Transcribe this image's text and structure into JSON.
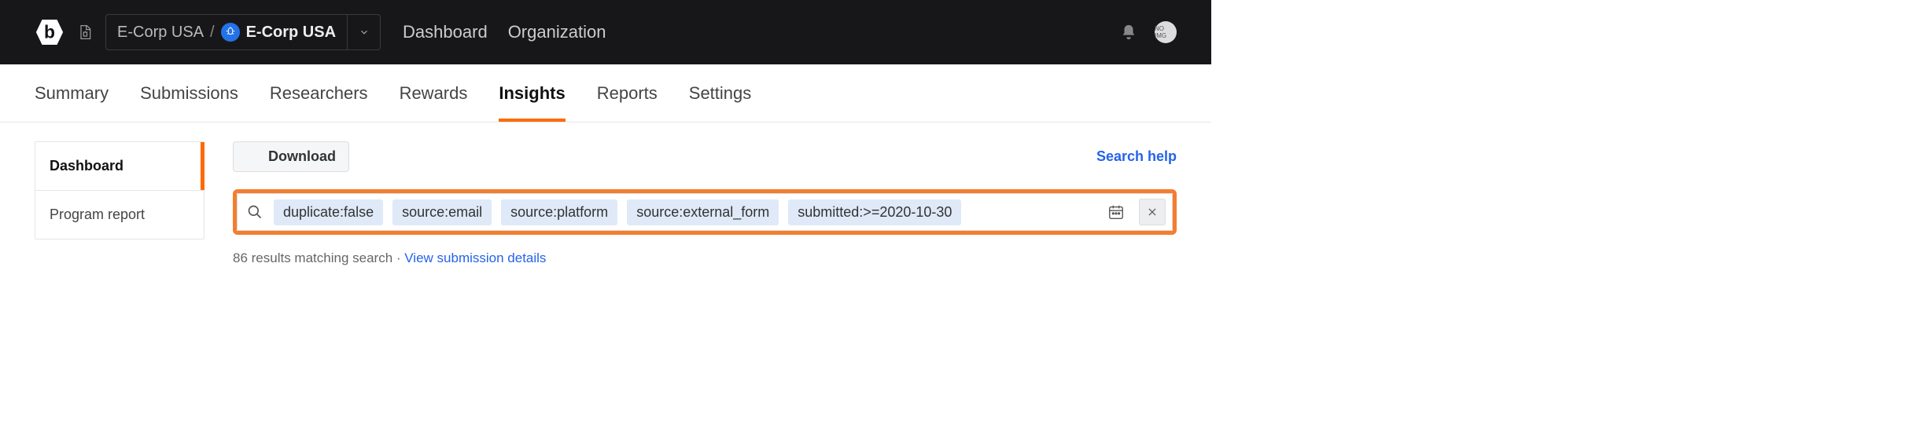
{
  "header": {
    "breadcrumb": {
      "parent": "E-Corp USA",
      "current": "E-Corp USA"
    },
    "nav": [
      "Dashboard",
      "Organization"
    ]
  },
  "subnav": {
    "items": [
      {
        "label": "Summary",
        "active": false
      },
      {
        "label": "Submissions",
        "active": false
      },
      {
        "label": "Researchers",
        "active": false
      },
      {
        "label": "Rewards",
        "active": false
      },
      {
        "label": "Insights",
        "active": true
      },
      {
        "label": "Reports",
        "active": false
      },
      {
        "label": "Settings",
        "active": false
      }
    ]
  },
  "sidebar": {
    "items": [
      {
        "label": "Dashboard",
        "active": true
      },
      {
        "label": "Program report",
        "active": false
      }
    ]
  },
  "toolbar": {
    "download_label": "Download",
    "search_help_label": "Search help"
  },
  "search": {
    "chips": [
      "duplicate:false",
      "source:email",
      "source:platform",
      "source:external_form",
      "submitted:>=2020-10-30"
    ]
  },
  "results": {
    "count_text": "86 results matching search",
    "separator": " · ",
    "link_text": "View submission details"
  }
}
